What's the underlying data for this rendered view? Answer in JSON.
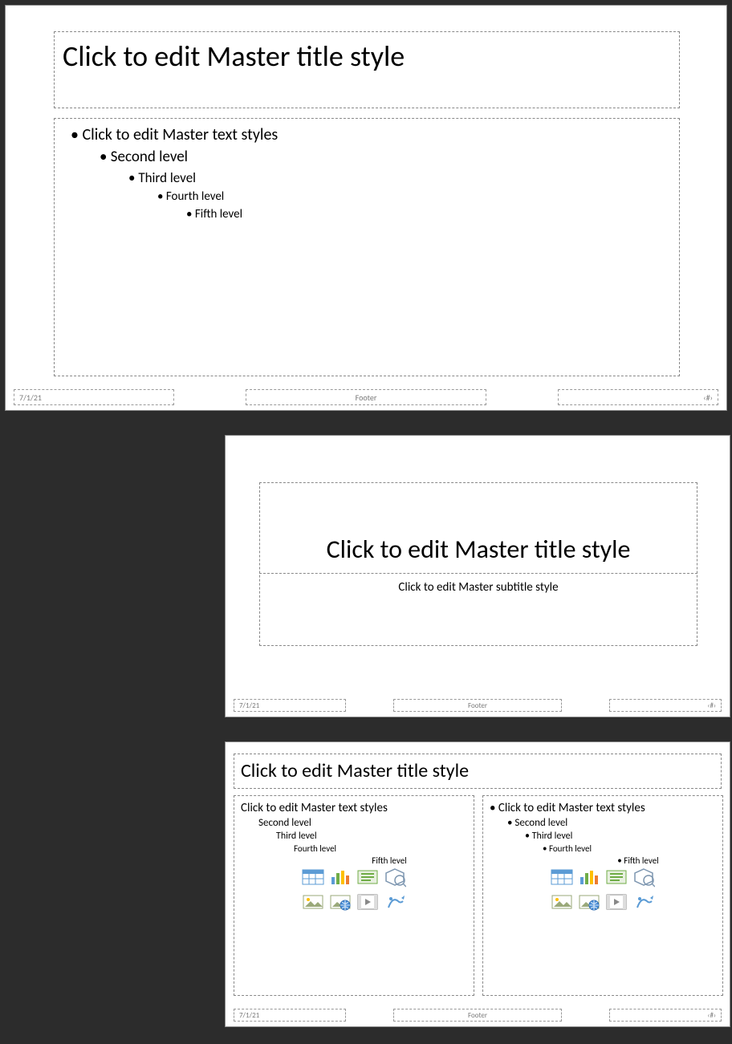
{
  "slide1": {
    "title": "Click to edit Master title style",
    "levels": {
      "l1": "Click to edit Master text styles",
      "l2": "Second level",
      "l3": "Third level",
      "l4": "Fourth level",
      "l5": "Fifth level"
    },
    "date": "7/1/21",
    "footer": "Footer",
    "pagenum": "‹#›"
  },
  "slide2": {
    "title": "Click to edit Master title style",
    "subtitle": "Click to edit Master subtitle style",
    "date": "7/1/21",
    "footer": "Footer",
    "pagenum": "‹#›"
  },
  "slide3": {
    "title": "Click to edit Master title style",
    "left": {
      "l1": "Click to edit Master text styles",
      "l2": "Second level",
      "l3": "Third level",
      "l4": "Fourth level",
      "l5": "Fifth level"
    },
    "right": {
      "l1": "Click to edit Master text styles",
      "l2": "Second level",
      "l3": "Third level",
      "l4": "Fourth level",
      "l5": "Fifth level"
    },
    "date": "7/1/21",
    "footer": "Footer",
    "pagenum": "‹#›"
  },
  "icons": {
    "table": "table-icon",
    "chart": "chart-icon",
    "smartart": "smartart-icon",
    "3dmodel": "3dmodel-icon",
    "picture": "picture-icon",
    "online": "online-picture-icon",
    "video": "video-icon",
    "stock": "stock-icon"
  }
}
